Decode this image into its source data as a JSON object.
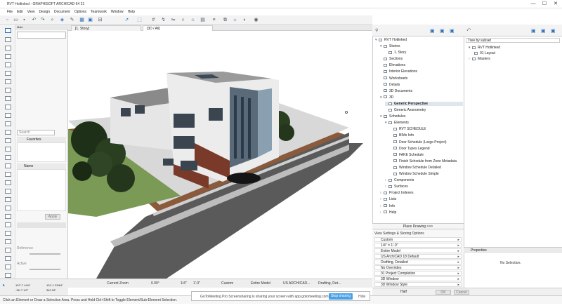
{
  "window": {
    "title": "RVT Hotlinked - GRAPHISOFT ARCHICAD-64 21",
    "controls": [
      "—",
      "☐",
      "✕"
    ]
  },
  "menu": [
    "File",
    "Edit",
    "View",
    "Design",
    "Document",
    "Options",
    "Teamwork",
    "Window",
    "Help"
  ],
  "tabs": [
    {
      "label": "[1. Story]",
      "active": false
    },
    {
      "label": "[3D / All]",
      "active": true
    }
  ],
  "left_panel": {
    "main_label": "Main",
    "search_placeholder": "Search",
    "favorites_label": "Favorites",
    "name_label": "Name",
    "apply_label": "Apply",
    "reference_label": "Reference",
    "active_label": "Active"
  },
  "viewport_status": {
    "zoom_label": "Current Zoom",
    "angle": "0.00°",
    "scale": "1/4\"",
    "scale_unit": "1'-0\"",
    "layer_combo": "Custom",
    "model_view": "Entire Model",
    "template": "US ARCHICAD...",
    "pen_set": "Drafting, Det..."
  },
  "coords": {
    "dx": "107'-7 1/64\"",
    "dy": "-36'-7 1/2\"",
    "dist": "101'-1 33/64\"",
    "angle": "340.93°"
  },
  "navigator": {
    "root": "RVT Hotlinked",
    "items": [
      {
        "label": "Stories",
        "indent": 1,
        "arrow": "▾"
      },
      {
        "label": "1. Story",
        "indent": 2,
        "arrow": ""
      },
      {
        "label": "Sections",
        "indent": 1,
        "arrow": ""
      },
      {
        "label": "Elevations",
        "indent": 1,
        "arrow": ""
      },
      {
        "label": "Interior Elevations",
        "indent": 1,
        "arrow": ""
      },
      {
        "label": "Worksheets",
        "indent": 1,
        "arrow": ""
      },
      {
        "label": "Details",
        "indent": 1,
        "arrow": ""
      },
      {
        "label": "3D Documents",
        "indent": 1,
        "arrow": ""
      },
      {
        "label": "3D",
        "indent": 1,
        "arrow": "▾"
      },
      {
        "label": "Generic Perspective",
        "indent": 2,
        "arrow": "",
        "selected": true
      },
      {
        "label": "Generic Axonometry",
        "indent": 2,
        "arrow": ""
      },
      {
        "label": "Schedules",
        "indent": 1,
        "arrow": "▾"
      },
      {
        "label": "Elements",
        "indent": 2,
        "arrow": "▾"
      },
      {
        "label": "RVT SCHEDULE",
        "indent": 3,
        "arrow": ""
      },
      {
        "label": "BIMx Info",
        "indent": 3,
        "arrow": ""
      },
      {
        "label": "Door Schedule (Large Project)",
        "indent": 3,
        "arrow": ""
      },
      {
        "label": "Door Types Legend",
        "indent": 3,
        "arrow": ""
      },
      {
        "label": "FAKE Schedule",
        "indent": 3,
        "arrow": ""
      },
      {
        "label": "Finish Schedule from Zone Metadata",
        "indent": 3,
        "arrow": ""
      },
      {
        "label": "Window Schedule Detailed",
        "indent": 3,
        "arrow": ""
      },
      {
        "label": "Window Schedule Simple",
        "indent": 3,
        "arrow": ""
      },
      {
        "label": "Components",
        "indent": 2,
        "arrow": "›"
      },
      {
        "label": "Surfaces",
        "indent": 2,
        "arrow": "›"
      },
      {
        "label": "Project Indexes",
        "indent": 1,
        "arrow": "›"
      },
      {
        "label": "Lists",
        "indent": 1,
        "arrow": "›"
      },
      {
        "label": "Info",
        "indent": 1,
        "arrow": "›"
      },
      {
        "label": "Help",
        "indent": 1,
        "arrow": "›"
      }
    ],
    "place_drawing": "Place Drawing >>>"
  },
  "view_settings": {
    "title": "View Settings & Storing Options",
    "rows": [
      "Custom",
      "1/4\"   =   1'-0\"",
      "Entire Model",
      "US ArchiCAD 18 Default",
      "Drafting, Detailed",
      "No Overrides",
      "01 Project Completion",
      "3D Window",
      "3D Window Style"
    ]
  },
  "organizer": {
    "dropdown": "Tree by subset",
    "root": "RVT Hotlinked",
    "items": [
      "01 Layout",
      "Masters"
    ],
    "properties_label": "Properties",
    "no_selection": "No Selection.",
    "half_label": "Half",
    "ok_label": "OK",
    "cancel_label": "Cancel"
  },
  "status_bar": {
    "text": "Click an Element or Draw a Selection Area. Press and Hold Ctrl+Shift to Toggle Element/Sub-Element Selection."
  },
  "gotomeeting": {
    "text": "GoToMeeting Pro Screensharing is sharing your screen with app.gotomeeting.com.",
    "stop_label": "Stop sharing",
    "hide_label": "Hide"
  }
}
